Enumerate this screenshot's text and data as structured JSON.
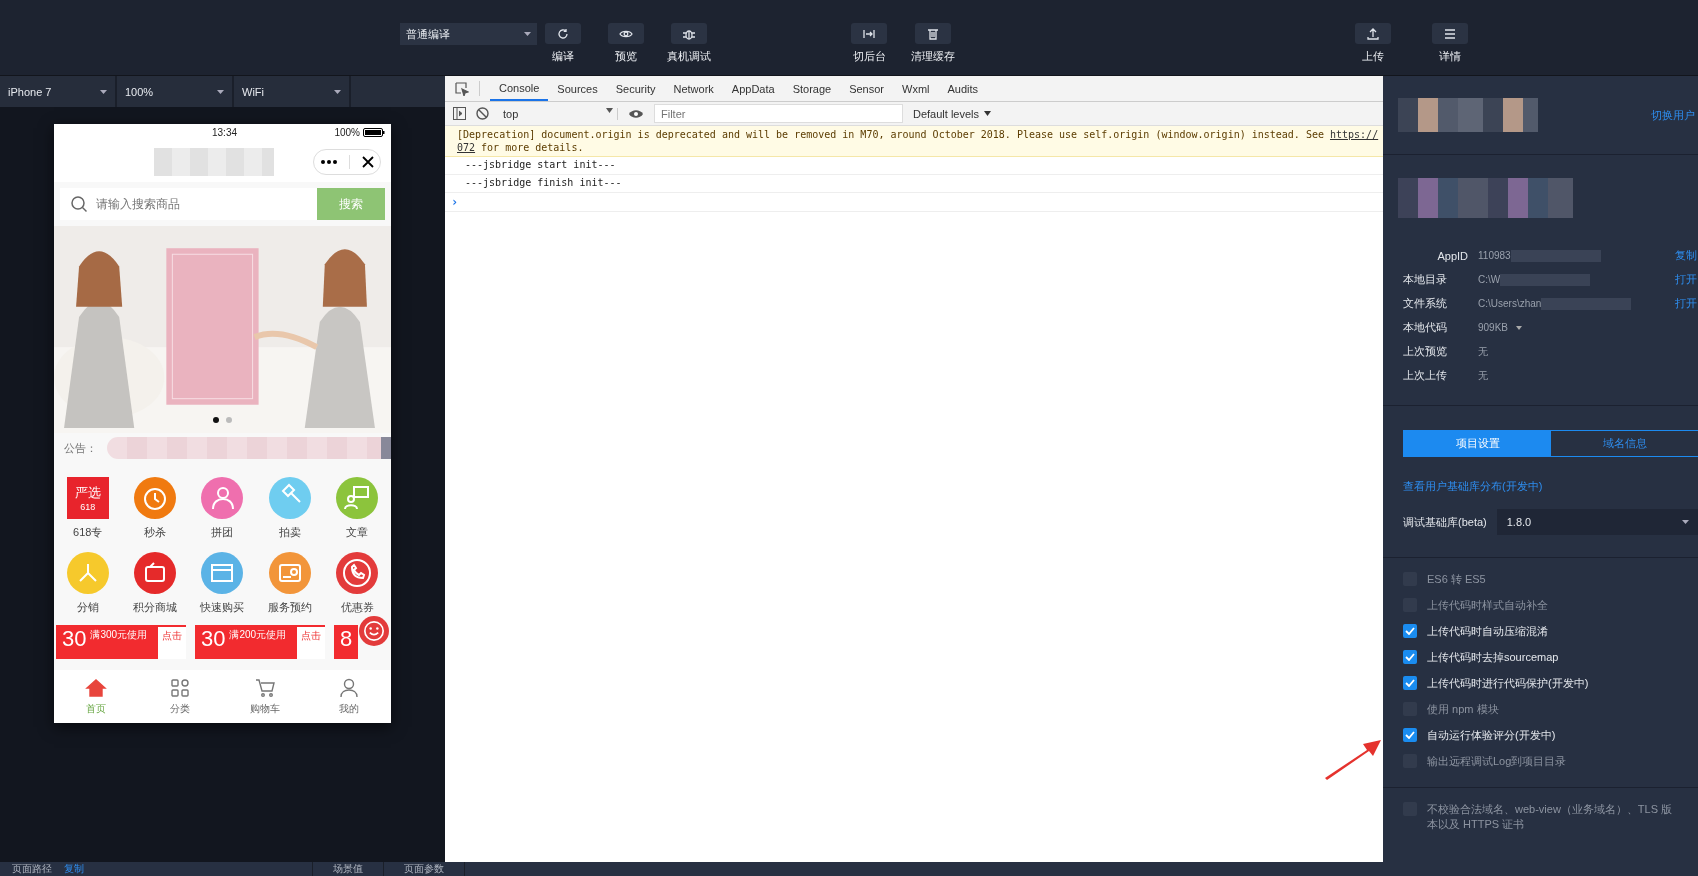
{
  "toolbar": {
    "compile_mode": "普通编译",
    "left_buttons": [
      {
        "label": "编译"
      },
      {
        "label": "预览"
      },
      {
        "label": "真机调试"
      }
    ],
    "mid_buttons": [
      {
        "label": "切后台"
      },
      {
        "label": "清理缓存"
      }
    ],
    "right_buttons": [
      {
        "label": "上传"
      },
      {
        "label": "详情"
      }
    ]
  },
  "device_bar": [
    "iPhone 7",
    "100%",
    "WiFi"
  ],
  "phone": {
    "time": "13:34",
    "battery": "100%",
    "search_placeholder": "请输入搜索商品",
    "search_button": "搜索",
    "dots": [
      {
        "selected": true
      },
      {
        "selected": false
      }
    ],
    "notice_label": "公告：",
    "grid": [
      {
        "label": "618专",
        "kind": "square",
        "color": "#e8242c",
        "lines": [
          "严选",
          "618"
        ]
      },
      {
        "label": "秒杀",
        "kind": "circle",
        "color": "#f07a10"
      },
      {
        "label": "拼团",
        "kind": "circle",
        "color": "#ef6fae"
      },
      {
        "label": "拍卖",
        "kind": "circle",
        "color": "#6fcdf0"
      },
      {
        "label": "文章",
        "kind": "circle",
        "color": "#8cc43c"
      },
      {
        "label": "分销",
        "kind": "circle",
        "color": "#f6c92c"
      },
      {
        "label": "积分商城",
        "kind": "circle",
        "color": "#e52a2a"
      },
      {
        "label": "快速购买",
        "kind": "circle",
        "color": "#5bb3e6"
      },
      {
        "label": "服务预约",
        "kind": "circle",
        "color": "#f2953a"
      },
      {
        "label": "优惠券",
        "kind": "circle",
        "color": "#e33b3b"
      }
    ],
    "coupons": [
      {
        "amount": "30",
        "condition": "满300元使用",
        "action": "点击"
      },
      {
        "amount": "30",
        "condition": "满200元使用",
        "action": "点击"
      },
      {
        "amount": "8"
      }
    ],
    "tabs": [
      {
        "label": "首页",
        "selected": true
      },
      {
        "label": "分类",
        "selected": false
      },
      {
        "label": "购物车",
        "selected": false
      },
      {
        "label": "我的",
        "selected": false
      }
    ]
  },
  "devtools": {
    "tabs": [
      {
        "label": "Console",
        "selected": true
      },
      {
        "label": "Sources",
        "selected": false
      },
      {
        "label": "Security",
        "selected": false
      },
      {
        "label": "Network",
        "selected": false
      },
      {
        "label": "AppData",
        "selected": false
      },
      {
        "label": "Storage",
        "selected": false
      },
      {
        "label": "Sensor",
        "selected": false
      },
      {
        "label": "Wxml",
        "selected": false
      },
      {
        "label": "Audits",
        "selected": false
      }
    ],
    "context": "top",
    "filter_placeholder": "Filter",
    "levels": "Default levels",
    "messages": [
      {
        "kind": "warning",
        "text": "[Deprecation] document.origin is deprecated and will be removed in M70, around October 2018. Please use self.origin (window.origin) instead. See ",
        "link": "https://",
        "link2": "072",
        "rest": " for more details."
      },
      {
        "kind": "log",
        "text": "---jsbridge start init---"
      },
      {
        "kind": "log",
        "text": "---jsbridge finish init---"
      }
    ],
    "prompt": "›"
  },
  "details": {
    "switch_user": "切换用户",
    "info": [
      {
        "label": "AppID",
        "value": "110983",
        "kind": "link",
        "action": "复制"
      },
      {
        "label": "本地目录",
        "value": "C:\\W",
        "kind": "link",
        "action": "打开"
      },
      {
        "label": "文件系统",
        "value": "C:\\Users\\zhan",
        "kind": "link",
        "action": "打开"
      },
      {
        "label": "本地代码",
        "value": "909KB",
        "kind": "dropdown"
      },
      {
        "label": "上次预览",
        "value": "无",
        "kind": "plain"
      },
      {
        "label": "上次上传",
        "value": "无",
        "kind": "plain"
      }
    ],
    "tabs": [
      {
        "label": "项目设置",
        "selected": true
      },
      {
        "label": "域名信息",
        "selected": false
      }
    ],
    "lib_link": "查看用户基础库分布(开发中)",
    "lib_label": "调试基础库(beta)",
    "lib_version": "1.8.0",
    "options": [
      {
        "label": "ES6 转 ES5",
        "checked": false
      },
      {
        "label": "上传代码时样式自动补全",
        "checked": false
      },
      {
        "label": "上传代码时自动压缩混淆",
        "checked": true
      },
      {
        "label": "上传代码时去掉sourcemap",
        "checked": true
      },
      {
        "label": "上传代码时进行代码保护(开发中)",
        "checked": true
      },
      {
        "label": "使用 npm 模块",
        "checked": false
      },
      {
        "label": "自动运行体验评分(开发中)",
        "checked": true
      },
      {
        "label": "输出远程调试Log到项目目录",
        "checked": false
      }
    ],
    "domain_option": {
      "label": "不校验合法域名、web-view（业务域名）、TLS 版本以及 HTTPS 证书",
      "checked": false
    }
  },
  "status_bar": {
    "path_label": "页面路径",
    "copy": "复制",
    "scene": "场景值",
    "params": "页面参数"
  }
}
